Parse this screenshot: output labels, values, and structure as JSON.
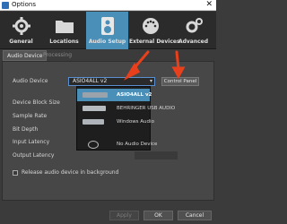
{
  "window": {
    "title": "Options",
    "close_symbol": "✕"
  },
  "toolbar": {
    "items": [
      {
        "label": "General",
        "icon": "gear-icon"
      },
      {
        "label": "Locations",
        "icon": "folder-icon"
      },
      {
        "label": "Audio Setup",
        "icon": "speaker-icon",
        "active": true
      },
      {
        "label": "External Devices",
        "icon": "midi-port-icon"
      },
      {
        "label": "Advanced",
        "icon": "gear-wrench-icon"
      }
    ],
    "active_color": "#4a8fb8"
  },
  "tabs": [
    {
      "label": "Audio Device",
      "active": true
    },
    {
      "label": "Processing",
      "active": false
    }
  ],
  "form": {
    "audio_device_label": "Audio Device",
    "audio_device_value": "ASIO4ALL v2",
    "control_panel_label": "Control Panel",
    "rows": [
      {
        "label": "Device Block Size"
      },
      {
        "label": "Sample Rate"
      },
      {
        "label": "Bit Depth"
      },
      {
        "label": "Input Latency"
      },
      {
        "label": "Output Latency"
      }
    ],
    "output_latency_hint": "",
    "release_checkbox_label": "Release audio device in background",
    "release_checked": false
  },
  "dropdown": {
    "items": [
      {
        "label": "ASIO4ALL v2",
        "icon": "audio-interface-icon",
        "selected": true
      },
      {
        "label": "BEHRINGER USB AUDIO",
        "icon": "usb-audio-icon",
        "selected": false
      },
      {
        "label": "Windows Audio",
        "icon": "windows-audio-icon",
        "selected": false
      },
      {
        "label": "No Audio Device",
        "icon": "no-device-icon",
        "selected": false
      }
    ]
  },
  "buttons": {
    "apply": "Apply",
    "ok": "OK",
    "cancel": "Cancel"
  },
  "annotation_color": "#e8401c"
}
